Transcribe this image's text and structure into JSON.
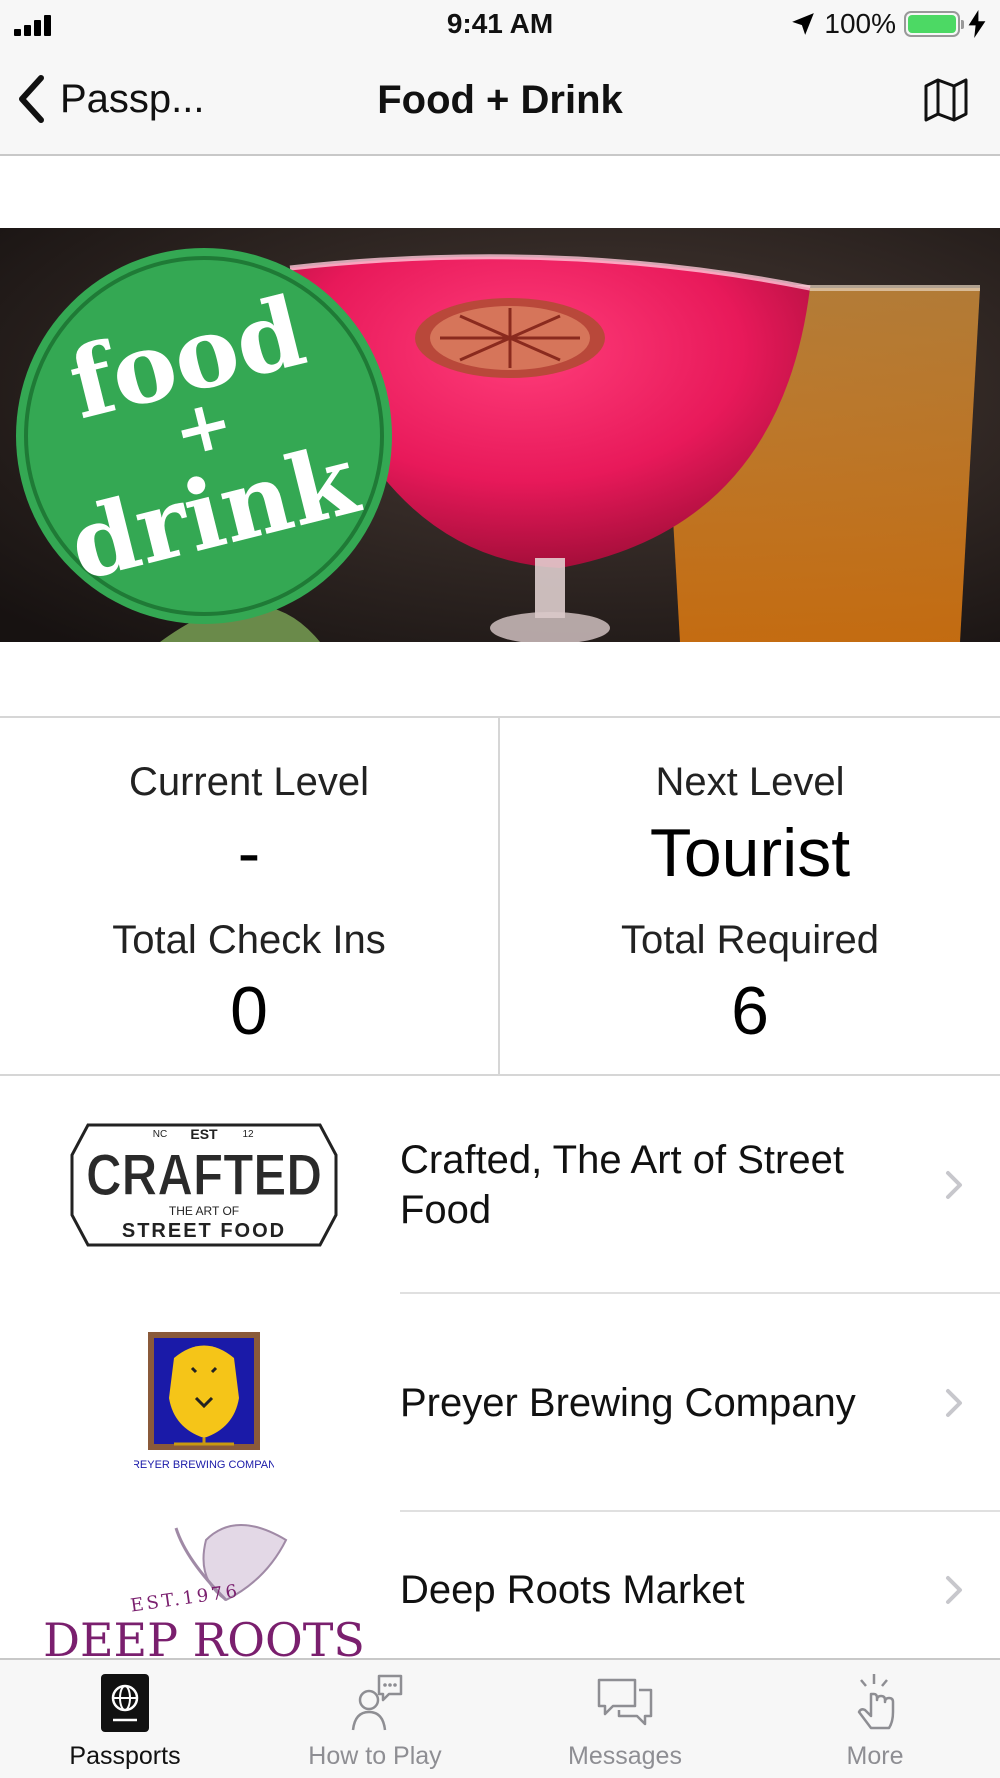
{
  "status_bar": {
    "time": "9:41 AM",
    "battery": "100%"
  },
  "nav": {
    "back_label": "Passp...",
    "title": "Food + Drink"
  },
  "hero": {
    "badge_line1": "food",
    "badge_line2": "+",
    "badge_line3": "drink",
    "badge_color": "#34a853"
  },
  "stats": {
    "current_level_label": "Current Level",
    "current_level_value": "-",
    "total_checkins_label": "Total Check Ins",
    "total_checkins_value": "0",
    "next_level_label": "Next Level",
    "next_level_value": "Tourist",
    "total_required_label": "Total Required",
    "total_required_value": "6"
  },
  "venues": [
    {
      "name": "Crafted, The Art of Street Food",
      "logo": {
        "line_top_left": "NC",
        "line_top_mid": "EST",
        "line_top_right": "12",
        "main": "CRAFTED",
        "sub1": "THE ART OF",
        "sub2": "STREET FOOD"
      }
    },
    {
      "name": "Preyer Brewing Company",
      "logo": {
        "caption": "PREYER BREWING COMPANY"
      }
    },
    {
      "name": "Deep Roots Market",
      "logo": {
        "est": "EST.1976",
        "main": "DEEP ROOTS"
      }
    }
  ],
  "tabs": [
    {
      "label": "Passports",
      "icon": "passport-icon",
      "active": true
    },
    {
      "label": "How to Play",
      "icon": "how-to-play-icon",
      "active": false
    },
    {
      "label": "Messages",
      "icon": "messages-icon",
      "active": false
    },
    {
      "label": "More",
      "icon": "more-icon",
      "active": false
    }
  ]
}
